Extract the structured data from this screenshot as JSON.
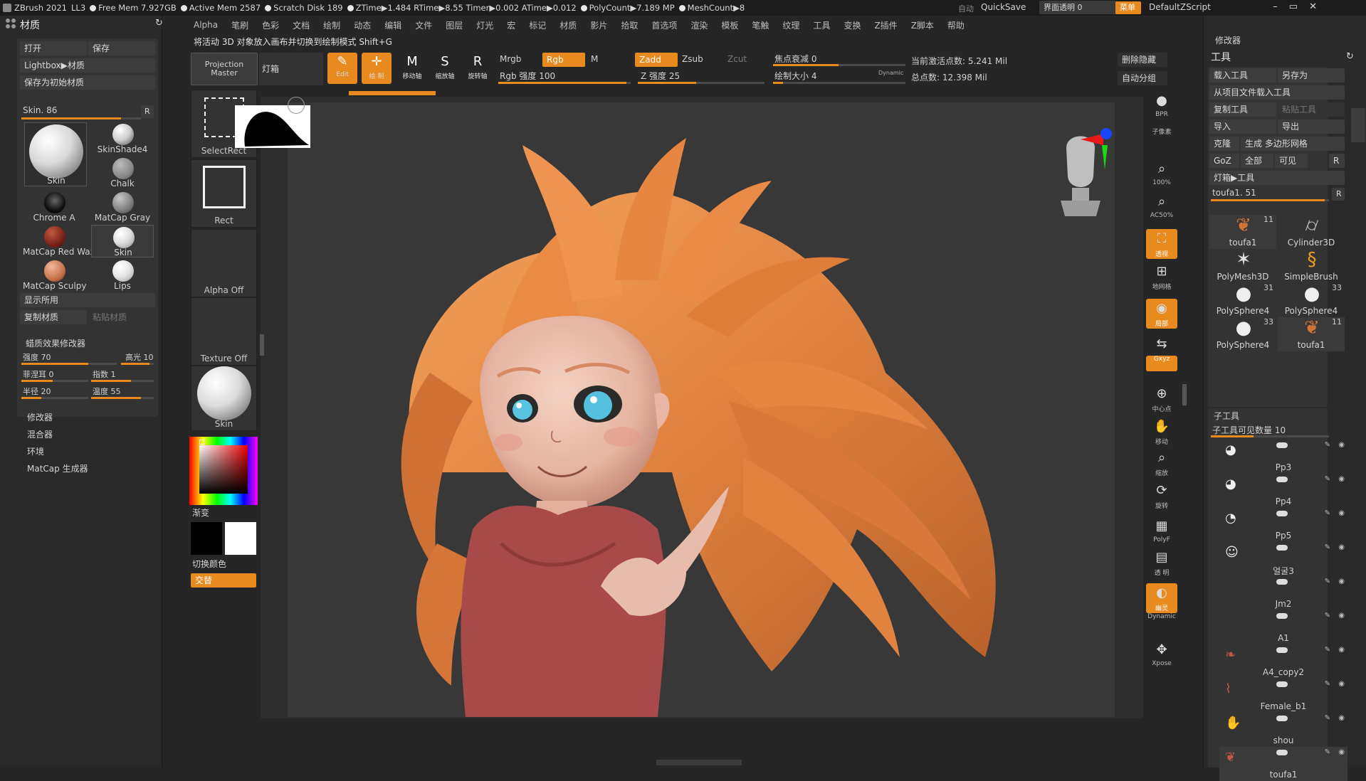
{
  "titlebar": {
    "app": "ZBrush 2021",
    "ll": "LL3",
    "free_mem": "Free Mem 7.927GB",
    "active_mem": "Active Mem 2587",
    "scratch": "Scratch Disk 189",
    "ztime": "ZTime▶1.484 RTime▶8.55 Timer▶0.002 ATime▶0.012",
    "polycount": "PolyCount▶7.189 MP",
    "meshcount": "MeshCount▶8",
    "auto": "自动",
    "quicksave": "QuickSave",
    "transparency": "界面透明 0",
    "menu": "菜单",
    "script": "DefaultZScript"
  },
  "menubar": [
    "Alpha",
    "笔刷",
    "色彩",
    "文档",
    "绘制",
    "动态",
    "编辑",
    "文件",
    "图层",
    "灯光",
    "宏",
    "标记",
    "材质",
    "影片",
    "拾取",
    "首选项",
    "渲染",
    "模板",
    "笔触",
    "纹理",
    "工具",
    "变换",
    "Z插件",
    "Z脚本",
    "帮助"
  ],
  "left": {
    "title": "材质",
    "open": "打开",
    "save": "保存",
    "lightbox": "Lightbox▶材质",
    "save_start": "保存为初始材质",
    "skin_slider": "Skin. 86",
    "r": "R",
    "materials": [
      "Skin",
      "SkinShade4",
      "Chalk",
      "Chrome A",
      "MatCap Gray",
      "MatCap Red Wax",
      "Skin",
      "MatCap Sculpy",
      "Lips"
    ],
    "show_used": "显示所用",
    "copy_mat": "复制材质",
    "paste_mat": "粘贴材质",
    "wax_title": "蜡质效果修改器",
    "strength": "强度 70",
    "highlight": "高光 10",
    "fresnel": "菲涅耳 0",
    "exponent": "指数 1",
    "radius": "半径 20",
    "temperature": "温度 55",
    "sections": [
      "修改器",
      "混合器",
      "环境",
      "MatCap 生成器"
    ]
  },
  "shelf": {
    "notice": "将活动 3D 对象放入画布并切换到绘制模式 Shift+G",
    "projection_master": "Projection Master",
    "lightbox": "灯箱",
    "select_rect": "SelectRect",
    "rect": "Rect",
    "alpha_off": "Alpha Off",
    "texture_off": "Texture Off",
    "skin": "Skin",
    "gradient": "渐变",
    "switch_color": "切换颜色",
    "alternate": "交替"
  },
  "toolbar": {
    "edit": "Edit",
    "draw": "绘 制",
    "move": "移动轴",
    "scale": "缩放轴",
    "rotate": "旋转轴",
    "mrgb": "Mrgb",
    "rgb": "Rgb",
    "m": "M",
    "rgb_strength": "Rgb 强度 100",
    "zadd": "Zadd",
    "zsub": "Zsub",
    "zcut": "Zcut",
    "z_strength": "Z 强度 25",
    "focal": "焦点衰减 0",
    "draw_size": "绘制大小 4",
    "dynamic": "Dynamic",
    "active_points": "当前激活点数: 5.241 Mil",
    "total_points": "总点数: 12.398 Mil",
    "del_hidden": "删除隐藏",
    "auto_group": "自动分组"
  },
  "right_strip": [
    "BPR",
    "子像素",
    "100%",
    "AC50%",
    "透视",
    "地网格",
    "局部",
    "对称",
    "Gxyz",
    "中心点",
    "移动",
    "缩放",
    "旋转",
    "PolyF",
    "透 明",
    "幽灵",
    "Dynamic",
    "Xpose"
  ],
  "right": {
    "modifiers": "修改器",
    "tool_title": "工具",
    "load_tool": "载入工具",
    "save_as": "另存为",
    "load_from_project": "从项目文件载入工具",
    "copy_tool": "复制工具",
    "paste_tool": "粘贴工具",
    "import": "导入",
    "export": "导出",
    "clone": "克隆",
    "make_polymesh": "生成 多边形网格",
    "goz": "GoZ",
    "all": "全部",
    "visible": "可见",
    "r": "R",
    "lightbox_tools": "灯箱▶工具",
    "tool_slider": "toufa1. 51",
    "tools": [
      {
        "name": "toufa1",
        "count": "11"
      },
      {
        "name": "Cylinder3D",
        "count": ""
      },
      {
        "name": "PolyMesh3D",
        "count": ""
      },
      {
        "name": "SimpleBrush",
        "count": ""
      },
      {
        "name": "PolySphere4",
        "count": "31"
      },
      {
        "name": "PolySphere4",
        "count": "33"
      },
      {
        "name": "PolySphere4",
        "count": "33"
      },
      {
        "name": "toufa1",
        "count": "11"
      }
    ],
    "subtool_title": "子工具",
    "visible_count": "子工具可见数量 10",
    "subtools": [
      "Pp3",
      "Pp4",
      "Pp5",
      "얼굴3",
      "Jm2",
      "A1",
      "A4_copy2",
      "Female_b1",
      "shou",
      "toufa1"
    ]
  },
  "colors": {
    "accent": "#e98a1f",
    "panel": "#2a2a2a",
    "hair": "#e0823f"
  }
}
